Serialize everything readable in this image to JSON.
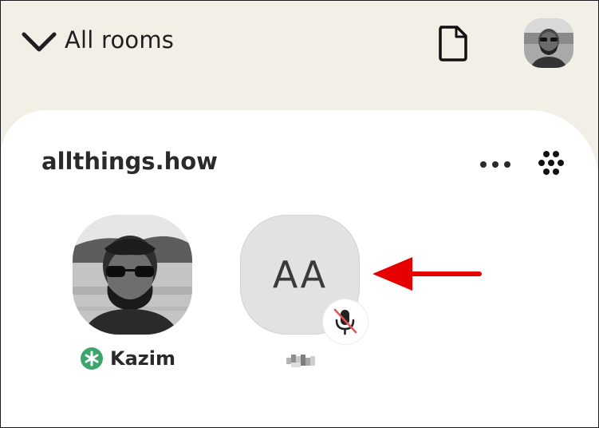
{
  "header": {
    "title": "All rooms",
    "back_icon": "chevron-down-icon",
    "doc_icon": "document-icon",
    "profile_icon": "user-avatar"
  },
  "room": {
    "name": "allthings.how",
    "more_icon": "more-horizontal-icon",
    "grid_icon": "dots-grid-icon"
  },
  "participants": [
    {
      "name": "Kazim",
      "badge": "moderator-asterisk-icon",
      "badge_color": "#3aa66c",
      "avatar": "photo"
    },
    {
      "name": "",
      "initials": "AA",
      "muted": true,
      "mute_icon": "mic-off-icon",
      "mute_color": "#e05555"
    }
  ],
  "annotation": {
    "arrow_color": "#e60000"
  }
}
